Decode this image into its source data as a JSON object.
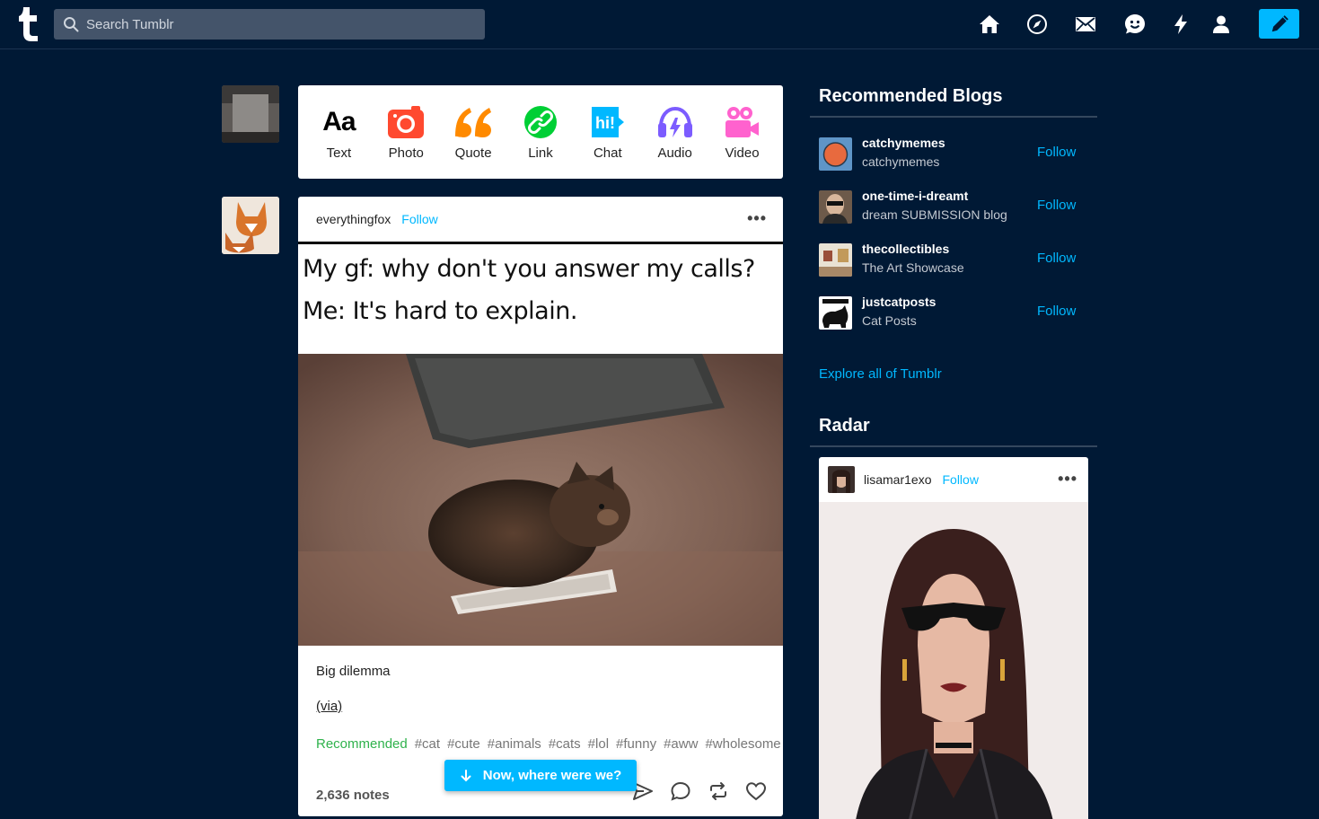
{
  "topbar": {
    "search_placeholder": "Search Tumblr"
  },
  "compose": {
    "types": [
      {
        "label": "Text",
        "icon": "text-aa-icon"
      },
      {
        "label": "Photo",
        "icon": "camera-icon",
        "color": "#ff492f"
      },
      {
        "label": "Quote",
        "icon": "quote-icon",
        "color": "#ff8a00"
      },
      {
        "label": "Link",
        "icon": "link-icon",
        "color": "#00cf35"
      },
      {
        "label": "Chat",
        "icon": "chat-hi-icon",
        "color": "#00b8ff",
        "glyph": "hi!"
      },
      {
        "label": "Audio",
        "icon": "headphones-icon",
        "color": "#7c5cff"
      },
      {
        "label": "Video",
        "icon": "video-camera-icon",
        "color": "#ff62ce"
      }
    ]
  },
  "post": {
    "blog": "everythingfox",
    "follow": "Follow",
    "more": "•••",
    "meme_line1": "My gf: why don't you answer my calls?",
    "meme_line2": "Me: It's hard to explain.",
    "caption": "Big dilemma",
    "via": "(via)",
    "recommended": "Recommended",
    "tags": [
      "#cat",
      "#cute",
      "#animals",
      "#cats",
      "#lol",
      "#funny",
      "#aww",
      "#wholesome"
    ],
    "notes": "2,636 notes"
  },
  "pill": {
    "label": "Now, where were we?"
  },
  "sidebar": {
    "recommended_title": "Recommended Blogs",
    "blogs": [
      {
        "name": "catchymemes",
        "sub": "catchymemes",
        "follow": "Follow"
      },
      {
        "name": "one-time-i-dreamt",
        "sub": "dream SUBMISSION blog",
        "follow": "Follow"
      },
      {
        "name": "thecollectibles",
        "sub": "The Art Showcase",
        "follow": "Follow"
      },
      {
        "name": "justcatposts",
        "sub": "Cat Posts",
        "follow": "Follow"
      }
    ],
    "explore": "Explore all of Tumblr",
    "radar_title": "Radar",
    "radar": {
      "blog": "lisamar1exo",
      "follow": "Follow",
      "more": "•••"
    }
  },
  "colors": {
    "background": "#001935",
    "accent": "#00b8ff",
    "recommended_green": "#2fb24c"
  }
}
